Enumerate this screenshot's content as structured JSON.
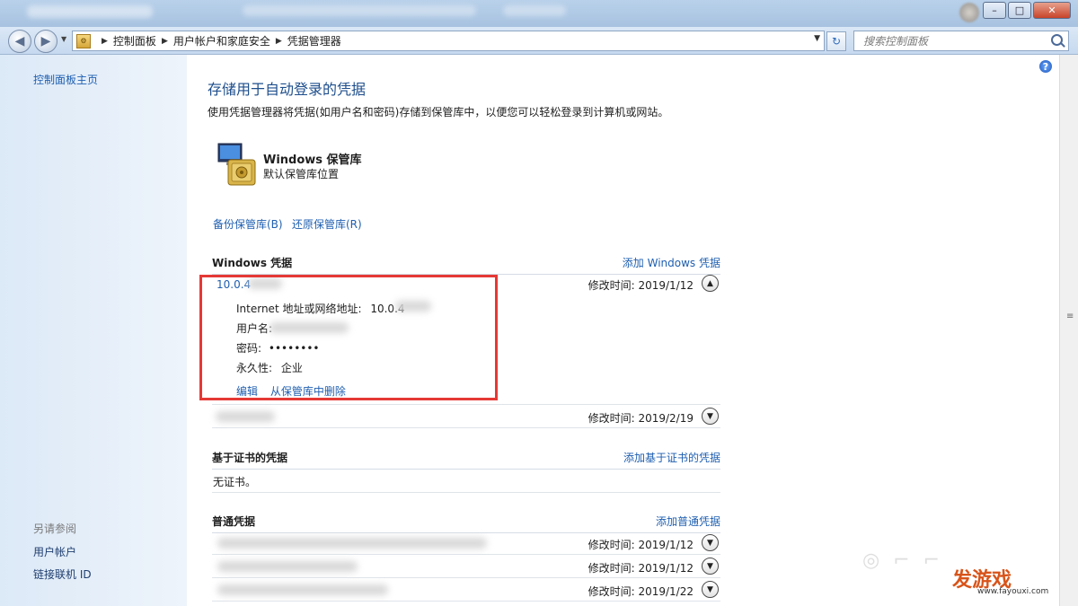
{
  "window": {
    "controls": {
      "minimize": "–",
      "maximize": "□",
      "close": "✕"
    }
  },
  "nav": {
    "back_icon": "back-arrow-icon",
    "forward_icon": "forward-arrow-icon",
    "breadcrumb": [
      "控制面板",
      "用户帐户和家庭安全",
      "凭据管理器"
    ],
    "search_placeholder": "搜索控制面板"
  },
  "sidebar": {
    "home": "控制面板主页",
    "see_also": "另请参阅",
    "links": [
      "用户帐户",
      "链接联机 ID"
    ]
  },
  "main": {
    "title": "存储用于自动登录的凭据",
    "description": "使用凭据管理器将凭据(如用户名和密码)存储到保管库中，以便您可以轻松登录到计算机或网站。",
    "vault": {
      "title": "Windows 保管库",
      "subtitle": "默认保管库位置"
    },
    "backup_link": "备份保管库(B)",
    "restore_link": "还原保管库(R)"
  },
  "windows_credentials": {
    "title": "Windows 凭据",
    "add": "添加 Windows 凭据",
    "items": [
      {
        "name": "10.0.4",
        "mtime": "修改时间: 2019/1/12",
        "expanded": true,
        "address_label": "Internet 地址或网络地址:",
        "address_value": "10.0.4",
        "user_label": "用户名:",
        "password_label": "密码:",
        "password_value": "••••••••",
        "persistence_label": "永久性:",
        "persistence_value": "企业",
        "edit": "编辑",
        "delete": "从保管库中删除"
      },
      {
        "mtime": "修改时间: 2019/2/19",
        "expanded": false
      }
    ]
  },
  "cert_credentials": {
    "title": "基于证书的凭据",
    "add": "添加基于证书的凭据",
    "empty": "无证书。"
  },
  "generic_credentials": {
    "title": "普通凭据",
    "add": "添加普通凭据",
    "items": [
      {
        "mtime": "修改时间: 2019/1/12"
      },
      {
        "mtime": "修改时间: 2019/1/12"
      },
      {
        "mtime": "修改时间: 2019/1/22"
      }
    ]
  },
  "watermark": {
    "brand": "发游戏",
    "url": "www.fayouxi.com"
  },
  "colors": {
    "link": "#1f5fb0",
    "title": "#1e4e8c",
    "highlight_box": "#e53935"
  }
}
